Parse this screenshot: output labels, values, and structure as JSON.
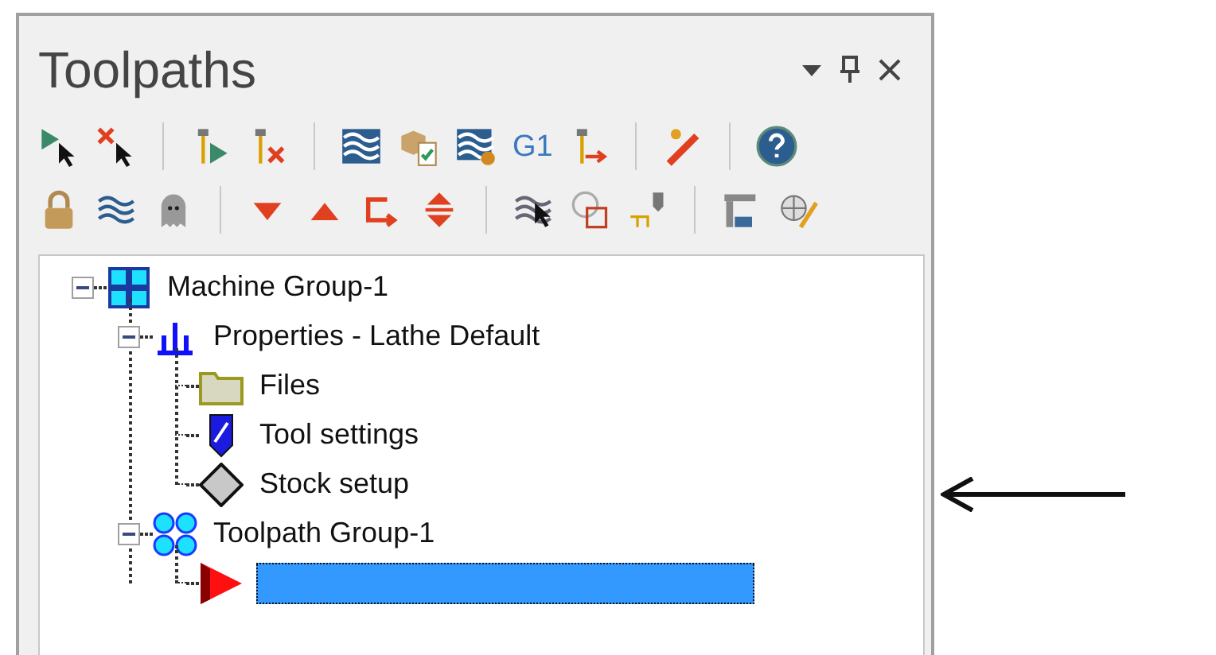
{
  "panel": {
    "title": "Toolpaths"
  },
  "toolbar": {
    "text_button": "G1"
  },
  "tree": [
    {
      "label": "Machine Group-1",
      "kind": "machine",
      "expanded": true,
      "selected": false,
      "children": [
        {
          "label": "Properties - Lathe Default",
          "kind": "properties",
          "expanded": true,
          "selected": false,
          "children": [
            {
              "label": "Files",
              "kind": "folder",
              "selected": false
            },
            {
              "label": "Tool settings",
              "kind": "tool",
              "selected": false
            },
            {
              "label": "Stock setup",
              "kind": "stock",
              "selected": false
            }
          ]
        },
        {
          "label": "Toolpath Group-1",
          "kind": "group",
          "expanded": true,
          "selected": false,
          "children": [
            {
              "kind": "operation",
              "selected": true
            }
          ]
        }
      ]
    }
  ]
}
